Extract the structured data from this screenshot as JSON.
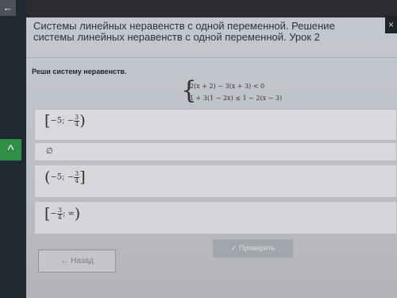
{
  "lesson": {
    "title": "Системы линейных неравенств с одной переменной. Решение системы линейных неравенств с одной переменной. Урок 2"
  },
  "task": {
    "prompt": "Реши систему неравенств.",
    "inequality1": "2(x + 2) − 3(x + 3) < 0",
    "inequality2": "1 + 3(1 − 2x) ≤ 1 − 2(x − 3)"
  },
  "answers": [
    {
      "left": "[",
      "prefix": "−5; −",
      "num": "3",
      "den": "4",
      "suffix": "",
      "right": ")"
    },
    {
      "text": "∅"
    },
    {
      "left": "(",
      "prefix": "−5; −",
      "num": "3",
      "den": "4",
      "suffix": "",
      "right": "]"
    },
    {
      "left": "[",
      "prefix": "−",
      "num": "3",
      "den": "4",
      "suffix": "; ∞",
      "right": ")"
    }
  ],
  "nav": {
    "back_label": "Назад",
    "back_icon": "arrow-left-icon",
    "check_label": "Проверить",
    "check_icon": "check-icon"
  },
  "ui": {
    "close_label": "×",
    "collapse_label": "^",
    "menu_label": "←"
  }
}
